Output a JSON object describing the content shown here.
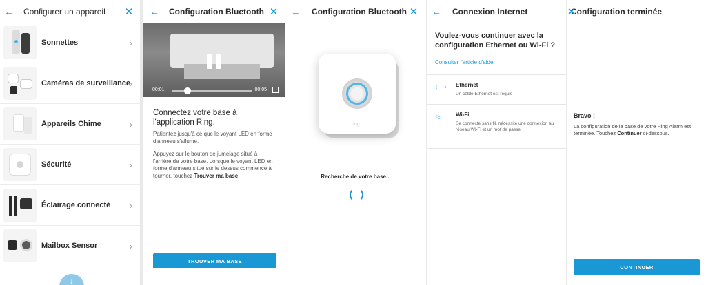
{
  "panel1": {
    "title": "Configurer un appareil",
    "items": [
      {
        "label": "Sonnettes"
      },
      {
        "label": "Caméras de surveillance"
      },
      {
        "label": "Appareils Chime"
      },
      {
        "label": "Sécurité"
      },
      {
        "label": "Éclairage connecté"
      },
      {
        "label": "Mailbox Sensor"
      }
    ]
  },
  "panel2": {
    "title": "Configuration Bluetooth",
    "video": {
      "current_time": "00:01",
      "duration": "00:05",
      "progress": 0.2
    },
    "heading": "Connectez votre base à l'application Ring.",
    "para1": "Patientez jusqu'à ce que le voyant LED en forme d'anneau s'allume.",
    "para2_start": "Appuyez sur le bouton de jumelage situé à l'arrière de votre base. Lorsque le voyant LED en forme d'anneau situé sur le dessus commence à tourner, touchez ",
    "para2_bold": "Trouver ma base",
    "para2_end": ".",
    "button": "TROUVER MA BASE"
  },
  "panel3": {
    "title": "Configuration Bluetooth",
    "device_logo": "ring",
    "status": "Recherche de votre base..."
  },
  "panel4": {
    "title": "Connexion Internet",
    "question": "Voulez-vous continuer avec la configuration Ethernet ou Wi-Fi ?",
    "help_link": "Consulter l'article d'aide",
    "options": [
      {
        "name": "Ethernet",
        "desc": "Un câble Ethernet est requis",
        "icon": "ethernet-icon"
      },
      {
        "name": "Wi-Fi",
        "desc": "Se connecte sans fil, nécessite une connexion au réseau Wi-Fi et un mot de passe",
        "icon": "wifi-icon"
      }
    ]
  },
  "panel5": {
    "title": "Configuration terminée",
    "heading": "Bravo !",
    "text_start": "La configuration de la base de votre Ring Alarm est terminée. Touchez ",
    "text_bold": "Continuer",
    "text_end": " ci-dessous.",
    "button": "CONTINUER"
  },
  "colors": {
    "accent": "#1998d5",
    "text": "#2b2b2b",
    "divider": "#e4e4e4"
  }
}
